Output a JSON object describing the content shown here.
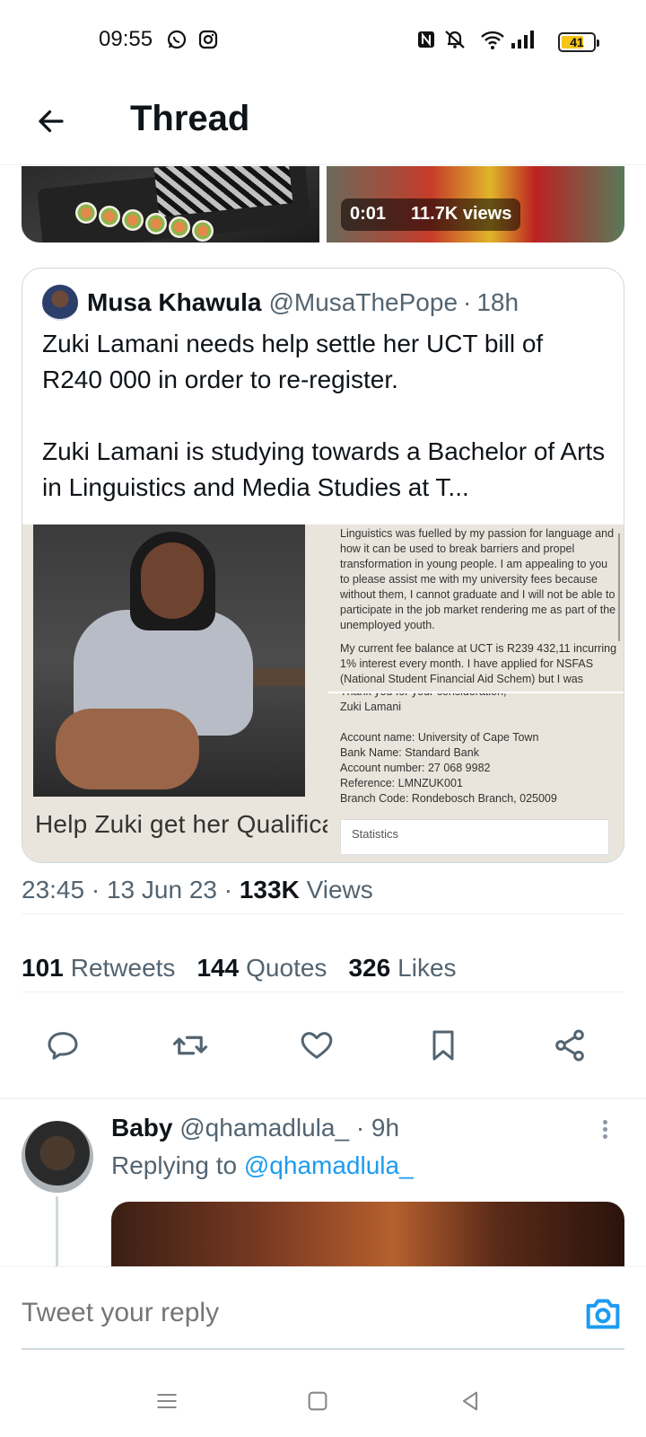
{
  "status_bar": {
    "time": "09:55",
    "battery": "41",
    "icons": [
      "whatsapp-icon",
      "instagram-icon",
      "nfc-icon",
      "mute-icon",
      "wifi-icon",
      "signal-icon"
    ]
  },
  "header": {
    "title": "Thread",
    "back_icon": "arrow-left-icon"
  },
  "top_media": {
    "video_duration": "0:01",
    "video_views": "11.7K views"
  },
  "quoted_tweet": {
    "name": "Musa Khawula",
    "handle": "@MusaThePope",
    "separator": "·",
    "time": "18h",
    "text_line1": "Zuki Lamani needs help settle her UCT bill of R240 000 in order to re-register.",
    "text_line2": "Zuki Lamani is studying towards a Bachelor of Arts in Linguistics and Media Studies at T...",
    "media_caption": "Help Zuki get her Qualification",
    "doc_top": [
      "Linguistics was fuelled by my passion for language and how it can be used to break barriers and propel transformation in young people. I am appealing to you to please assist me with my university fees because without them, I cannot graduate and I will not be able to participate in the job market rendering me as part of the unemployed youth.",
      "My current fee balance at UCT is R239 432,11 incurring 1% interest every month. I have applied for NSFAS (National Student Financial Aid Schem) but I was"
    ],
    "doc_bottom": [
      "Thank you for your consideration,",
      "Zuki Lamani",
      "Account name: University of Cape Town",
      "Bank Name: Standard Bank",
      "Account number: 27 068 9982",
      "Reference: LMNZUK001",
      "Branch Code: Rondebosch Branch, 025009"
    ],
    "doc_stats_label": "Statistics"
  },
  "tweet_meta": {
    "time": "23:45",
    "dot": "·",
    "date": "13 Jun 23",
    "views_count": "133K",
    "views_label": "Views"
  },
  "stats": {
    "retweets_count": "101",
    "retweets_label": "Retweets",
    "quotes_count": "144",
    "quotes_label": "Quotes",
    "likes_count": "326",
    "likes_label": "Likes"
  },
  "actions": [
    "reply-icon",
    "retweet-icon",
    "like-icon",
    "bookmark-icon",
    "share-icon"
  ],
  "reply": {
    "name": "Baby",
    "handle": "@qhamadlula_",
    "separator": "·",
    "time": "9h",
    "replying_prefix": "Replying to",
    "replying_mention": "@qhamadlula_"
  },
  "reply_bar": {
    "placeholder": "Tweet your reply"
  },
  "colors": {
    "accent": "#1d9bf0",
    "text_primary": "#0f1419",
    "text_secondary": "#536471",
    "border": "#cfd9de"
  }
}
